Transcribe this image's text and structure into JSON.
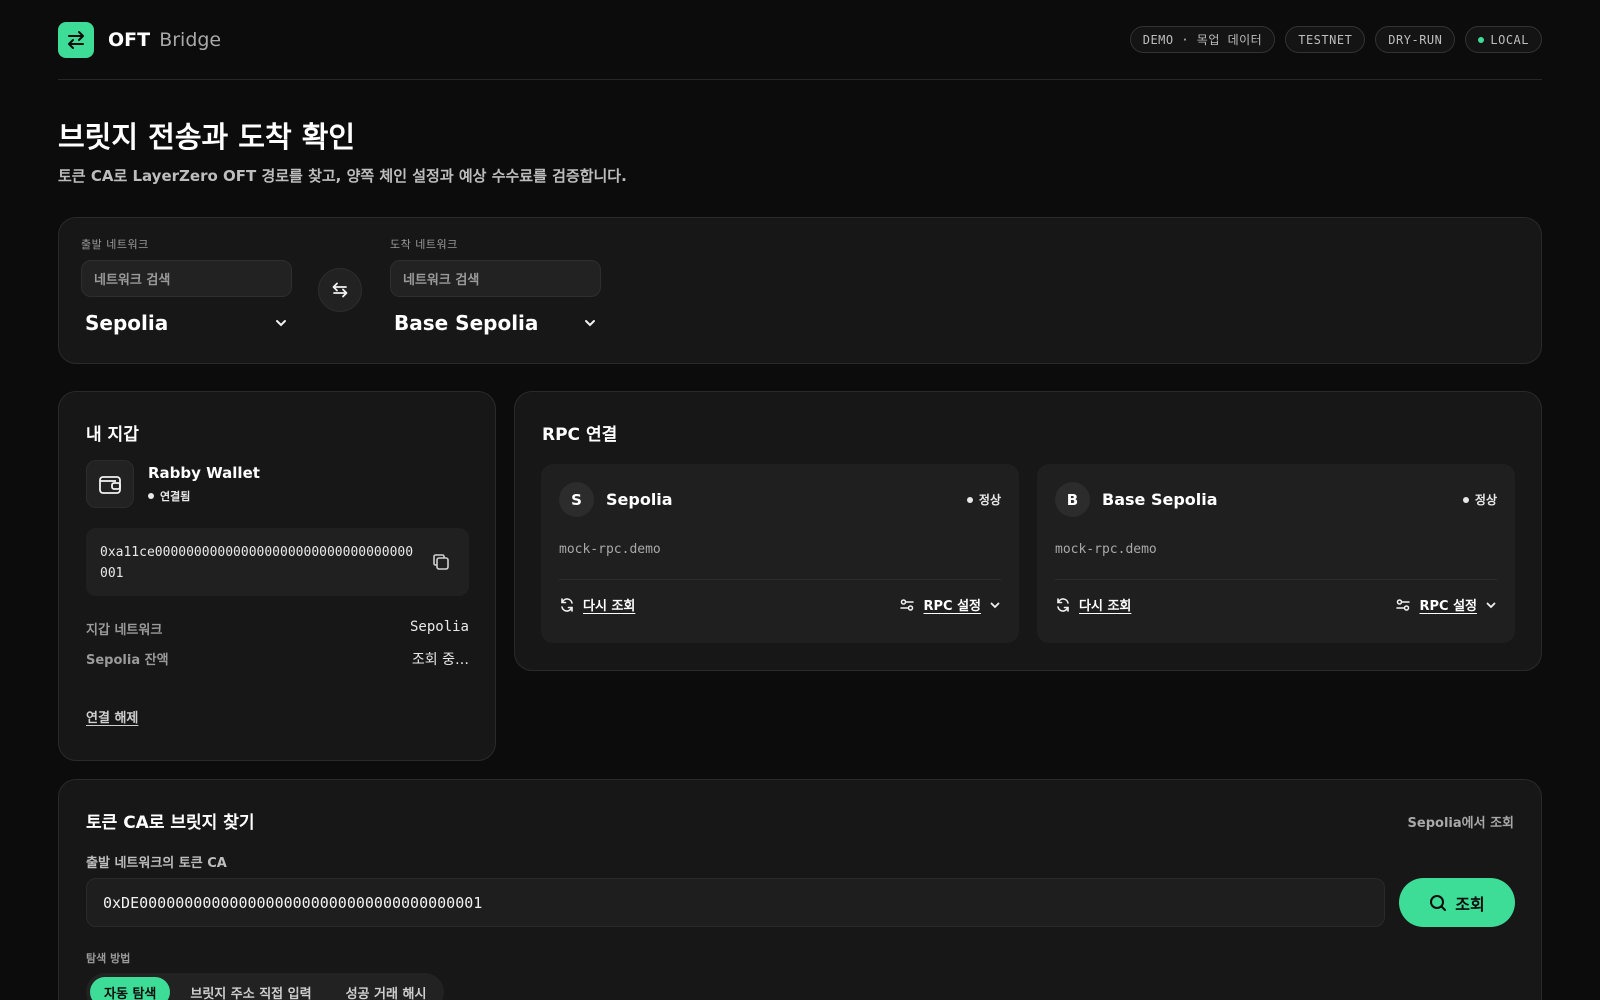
{
  "header": {
    "brand_bold": "OFT",
    "brand_light": "Bridge",
    "badges": [
      "DEMO · 목업 데이터",
      "TESTNET",
      "DRY-RUN",
      "LOCAL"
    ]
  },
  "page": {
    "title": "브릿지 전송과 도착 확인",
    "subtitle": "토큰 CA로 LayerZero OFT 경로를 찾고, 양쪽 체인 설정과 예상 수수료를 검증합니다."
  },
  "networks": {
    "from_label": "출발 네트워크",
    "to_label": "도착 네트워크",
    "search_placeholder": "네트워크 검색",
    "from_value": "Sepolia",
    "to_value": "Base Sepolia"
  },
  "wallet": {
    "title": "내 지갑",
    "name": "Rabby Wallet",
    "status": "연결됨",
    "address": "0xa11ce000000000000000000000000000000000001",
    "network_label": "지갑 네트워크",
    "network_value": "Sepolia",
    "balance_label": "Sepolia 잔액",
    "balance_value": "조회 중…",
    "disconnect": "연결 해제"
  },
  "rpc": {
    "title": "RPC 연결",
    "items": [
      {
        "initial": "S",
        "name": "Sepolia",
        "status": "정상",
        "url": "mock-rpc.demo",
        "refresh": "다시 조회",
        "settings": "RPC 설정"
      },
      {
        "initial": "B",
        "name": "Base Sepolia",
        "status": "정상",
        "url": "mock-rpc.demo",
        "refresh": "다시 조회",
        "settings": "RPC 설정"
      }
    ]
  },
  "token": {
    "title": "토큰 CA로 브릿지 찾기",
    "note": "Sepolia에서 조회",
    "field_label": "출발 네트워크의 토큰 CA",
    "ca_value": "0xDE00000000000000000000000000000000000001",
    "search_button": "조회",
    "method_label": "탐색 방법",
    "methods": [
      "자동 탐색",
      "브릿지 주소 직접 입력",
      "성공 거래 해시"
    ]
  },
  "colors": {
    "accent": "#3ddc97",
    "background": "#0c0c0c",
    "card": "#171717"
  }
}
